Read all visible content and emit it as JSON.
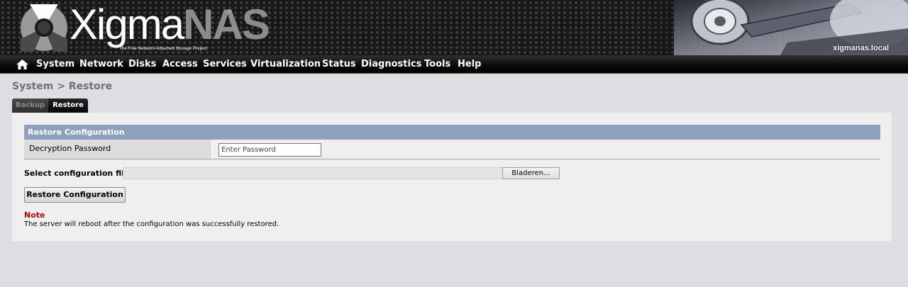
{
  "header": {
    "logo_text_part1": "Xigma",
    "logo_text_part2": "NAS",
    "registered_mark": "®",
    "tagline": "The Free Network-Attached Storage Project",
    "hostname": "xigmanas.local"
  },
  "nav": {
    "home_icon": "home-icon",
    "items": [
      {
        "label": "System"
      },
      {
        "label": "Network"
      },
      {
        "label": "Disks"
      },
      {
        "label": "Access"
      },
      {
        "label": "Services"
      },
      {
        "label": "Virtualization"
      },
      {
        "label": "Status"
      },
      {
        "label": "Diagnostics"
      },
      {
        "label": "Tools"
      },
      {
        "label": "Help"
      }
    ]
  },
  "page": {
    "breadcrumb": "System > Restore",
    "tabs": [
      {
        "label": "Backup",
        "active": false
      },
      {
        "label": "Restore",
        "active": true
      }
    ]
  },
  "form": {
    "section_title": "Restore Configuration",
    "password_label": "Decryption Password",
    "password_placeholder": "Enter Password",
    "password_value": "",
    "file_label": "Select configuration file:",
    "file_value": "",
    "browse_label": "Bladeren...",
    "submit_label": "Restore Configuration"
  },
  "note": {
    "title": "Note",
    "text": "The server will reboot after the configuration was successfully restored."
  },
  "colors": {
    "section_header": "#8ea1bc",
    "note_title": "#c00000",
    "background": "#dcdee3",
    "content": "#efefef"
  }
}
